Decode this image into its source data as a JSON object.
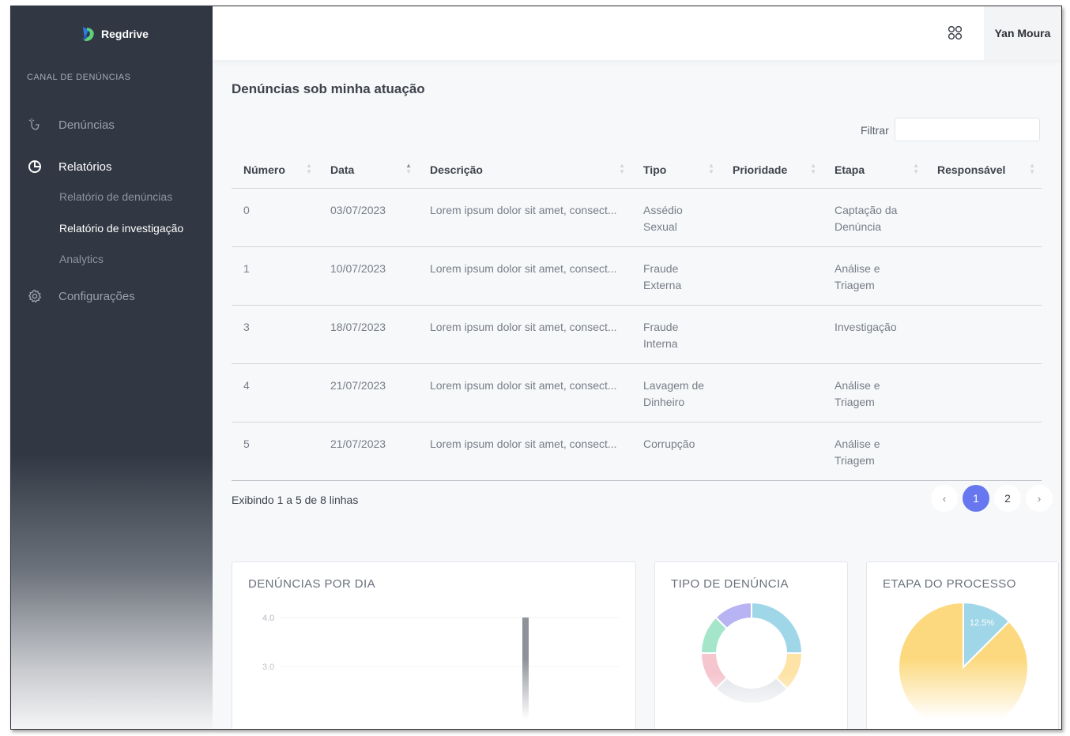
{
  "app": {
    "brand": "Regdrive"
  },
  "sidebar": {
    "section_label": "CANAL DE DENÚNCIAS",
    "items": [
      {
        "label": "Denúncias",
        "icon": "hand-pointer-icon"
      },
      {
        "label": "Relatórios",
        "icon": "pie-chart-icon",
        "active": true
      },
      {
        "label": "Configurações",
        "icon": "gear-icon"
      }
    ],
    "sub_items": [
      {
        "label": "Relatório de denúncias"
      },
      {
        "label": "Relatório de investigação",
        "active": true
      },
      {
        "label": "Analytics"
      }
    ]
  },
  "header": {
    "user_name": "Yan Moura",
    "apps_icon": "apps-grid-icon"
  },
  "main": {
    "title": "Denúncias sob minha atuação",
    "filter_label": "Filtrar",
    "filter_value": "",
    "columns": [
      "Número",
      "Data",
      "Descrição",
      "Tipo",
      "Prioridade",
      "Etapa",
      "Responsável"
    ],
    "sorted_column": "Data",
    "rows": [
      {
        "numero": "0",
        "data": "03/07/2023",
        "descricao": "Lorem ipsum dolor sit amet, consect...",
        "tipo": [
          "Assédio",
          "Sexual"
        ],
        "prioridade": "",
        "etapa": [
          "Captação da",
          "Denúncia"
        ],
        "responsavel": ""
      },
      {
        "numero": "1",
        "data": "10/07/2023",
        "descricao": "Lorem ipsum dolor sit amet, consect...",
        "tipo": [
          "Fraude",
          "Externa"
        ],
        "prioridade": "",
        "etapa": [
          "Análise e",
          "Triagem"
        ],
        "responsavel": ""
      },
      {
        "numero": "3",
        "data": "18/07/2023",
        "descricao": "Lorem ipsum dolor sit amet, consect...",
        "tipo": [
          "Fraude",
          "Interna"
        ],
        "prioridade": "",
        "etapa": [
          "Investigação"
        ],
        "responsavel": ""
      },
      {
        "numero": "4",
        "data": "21/07/2023",
        "descricao": "Lorem ipsum dolor sit amet, consect...",
        "tipo": [
          "Lavagem de",
          "Dinheiro"
        ],
        "prioridade": "",
        "etapa": [
          "Análise e",
          "Triagem"
        ],
        "responsavel": ""
      },
      {
        "numero": "5",
        "data": "21/07/2023",
        "descricao": "Lorem ipsum dolor sit amet, consect...",
        "tipo": [
          "Corrupção"
        ],
        "prioridade": "",
        "etapa": [
          "Análise e",
          "Triagem"
        ],
        "responsavel": ""
      }
    ],
    "showing_text": "Exibindo 1 a 5 de 8 linhas",
    "pagination": {
      "prev": "‹",
      "pages": [
        "1",
        "2"
      ],
      "current": "1",
      "next": "›"
    }
  },
  "cards": {
    "per_day": {
      "title": "DENÚNCIAS POR DIA"
    },
    "type": {
      "title": "TIPO DE DENÚNCIA"
    },
    "stage": {
      "title": "ETAPA DO PROCESSO"
    }
  },
  "chart_data": [
    {
      "type": "bar",
      "title": "DENÚNCIAS POR DIA",
      "yticks": [
        "4.0",
        "3.0"
      ],
      "ylim": [
        2,
        4
      ],
      "values": [
        4
      ],
      "colors": [
        "#8e9299"
      ]
    },
    {
      "type": "pie",
      "donut": true,
      "title": "TIPO DE DENÚNCIA",
      "values": [
        0.25,
        0.125,
        0.25,
        0.125,
        0.125,
        0.125
      ],
      "colors": [
        "#9fd6e8",
        "#fde4a6",
        "#e3e5ea",
        "#f6c6cf",
        "#a5e6cb",
        "#b8b3f2"
      ]
    },
    {
      "type": "pie",
      "title": "ETAPA DO PROCESSO",
      "values": [
        0.125,
        0.875
      ],
      "labels": [
        "12.5%",
        ""
      ],
      "colors": [
        "#9fd6e8",
        "#fcd97e"
      ]
    }
  ]
}
